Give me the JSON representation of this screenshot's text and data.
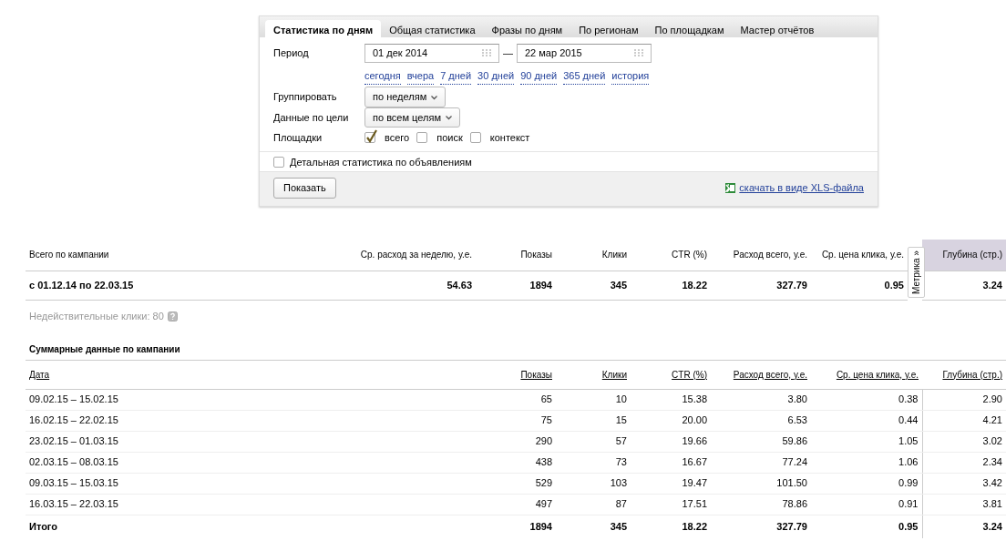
{
  "report_form": {
    "tabs": [
      {
        "label": "Статистика по дням",
        "selected": true
      },
      {
        "label": "Общая статистика",
        "selected": false
      },
      {
        "label": "Фразы по дням",
        "selected": false
      },
      {
        "label": "По регионам",
        "selected": false
      },
      {
        "label": "По площадкам",
        "selected": false
      },
      {
        "label": "Мастер отчётов",
        "selected": false
      }
    ],
    "period": {
      "label": "Период",
      "from": "01 дек 2014",
      "separator": "—",
      "to": "22 мар 2015",
      "quick_links": [
        "сегодня",
        "вчера",
        "7 дней",
        "30 дней",
        "90 дней",
        "365 дней",
        "история"
      ]
    },
    "grouping": {
      "label": "Группировать",
      "value": "по неделям"
    },
    "goal": {
      "label": "Данные по цели",
      "value": "по всем целям"
    },
    "platforms": {
      "label": "Площадки",
      "options": [
        {
          "label": "всего",
          "checked": true
        },
        {
          "label": "поиск",
          "checked": false
        },
        {
          "label": "контекст",
          "checked": false
        }
      ]
    },
    "detailed": {
      "label": "Детальная статистика по объявлениям",
      "checked": false
    },
    "show_button": "Показать",
    "download_link": "скачать в виде XLS-файла"
  },
  "campaign_total": {
    "columns": [
      "Всего по кампании",
      "Ср. расход за неделю, у.е.",
      "Показы",
      "Клики",
      "CTR (%)",
      "Расход всего, у.е.",
      "Ср. цена клика, у.е.",
      "Глубина (стр.)"
    ],
    "row": [
      "с 01.12.14 по 22.03.15",
      "54.63",
      "1894",
      "345",
      "18.22",
      "327.79",
      "0.95",
      "3.24"
    ],
    "metrika_tab": "Метрика »"
  },
  "invalid_clicks": "Недействительные клики: 80",
  "summary": {
    "title": "Суммарные данные по кампании",
    "columns": [
      "Дата",
      "Показы",
      "Клики",
      "CTR (%)",
      "Расход всего, у.е.",
      "Ср. цена клика, у.е.",
      "Глубина (стр.)"
    ],
    "rows": [
      [
        "09.02.15 – 15.02.15",
        "65",
        "10",
        "15.38",
        "3.80",
        "0.38",
        "2.90"
      ],
      [
        "16.02.15 – 22.02.15",
        "75",
        "15",
        "20.00",
        "6.53",
        "0.44",
        "4.21"
      ],
      [
        "23.02.15 – 01.03.15",
        "290",
        "57",
        "19.66",
        "59.86",
        "1.05",
        "3.02"
      ],
      [
        "02.03.15 – 08.03.15",
        "438",
        "73",
        "16.67",
        "77.24",
        "1.06",
        "2.34"
      ],
      [
        "09.03.15 – 15.03.15",
        "529",
        "103",
        "19.47",
        "101.50",
        "0.99",
        "3.42"
      ],
      [
        "16.03.15 – 22.03.15",
        "497",
        "87",
        "17.51",
        "78.86",
        "0.91",
        "3.81"
      ]
    ],
    "total": [
      "Итого",
      "1894",
      "345",
      "18.22",
      "327.79",
      "0.95",
      "3.24"
    ]
  }
}
